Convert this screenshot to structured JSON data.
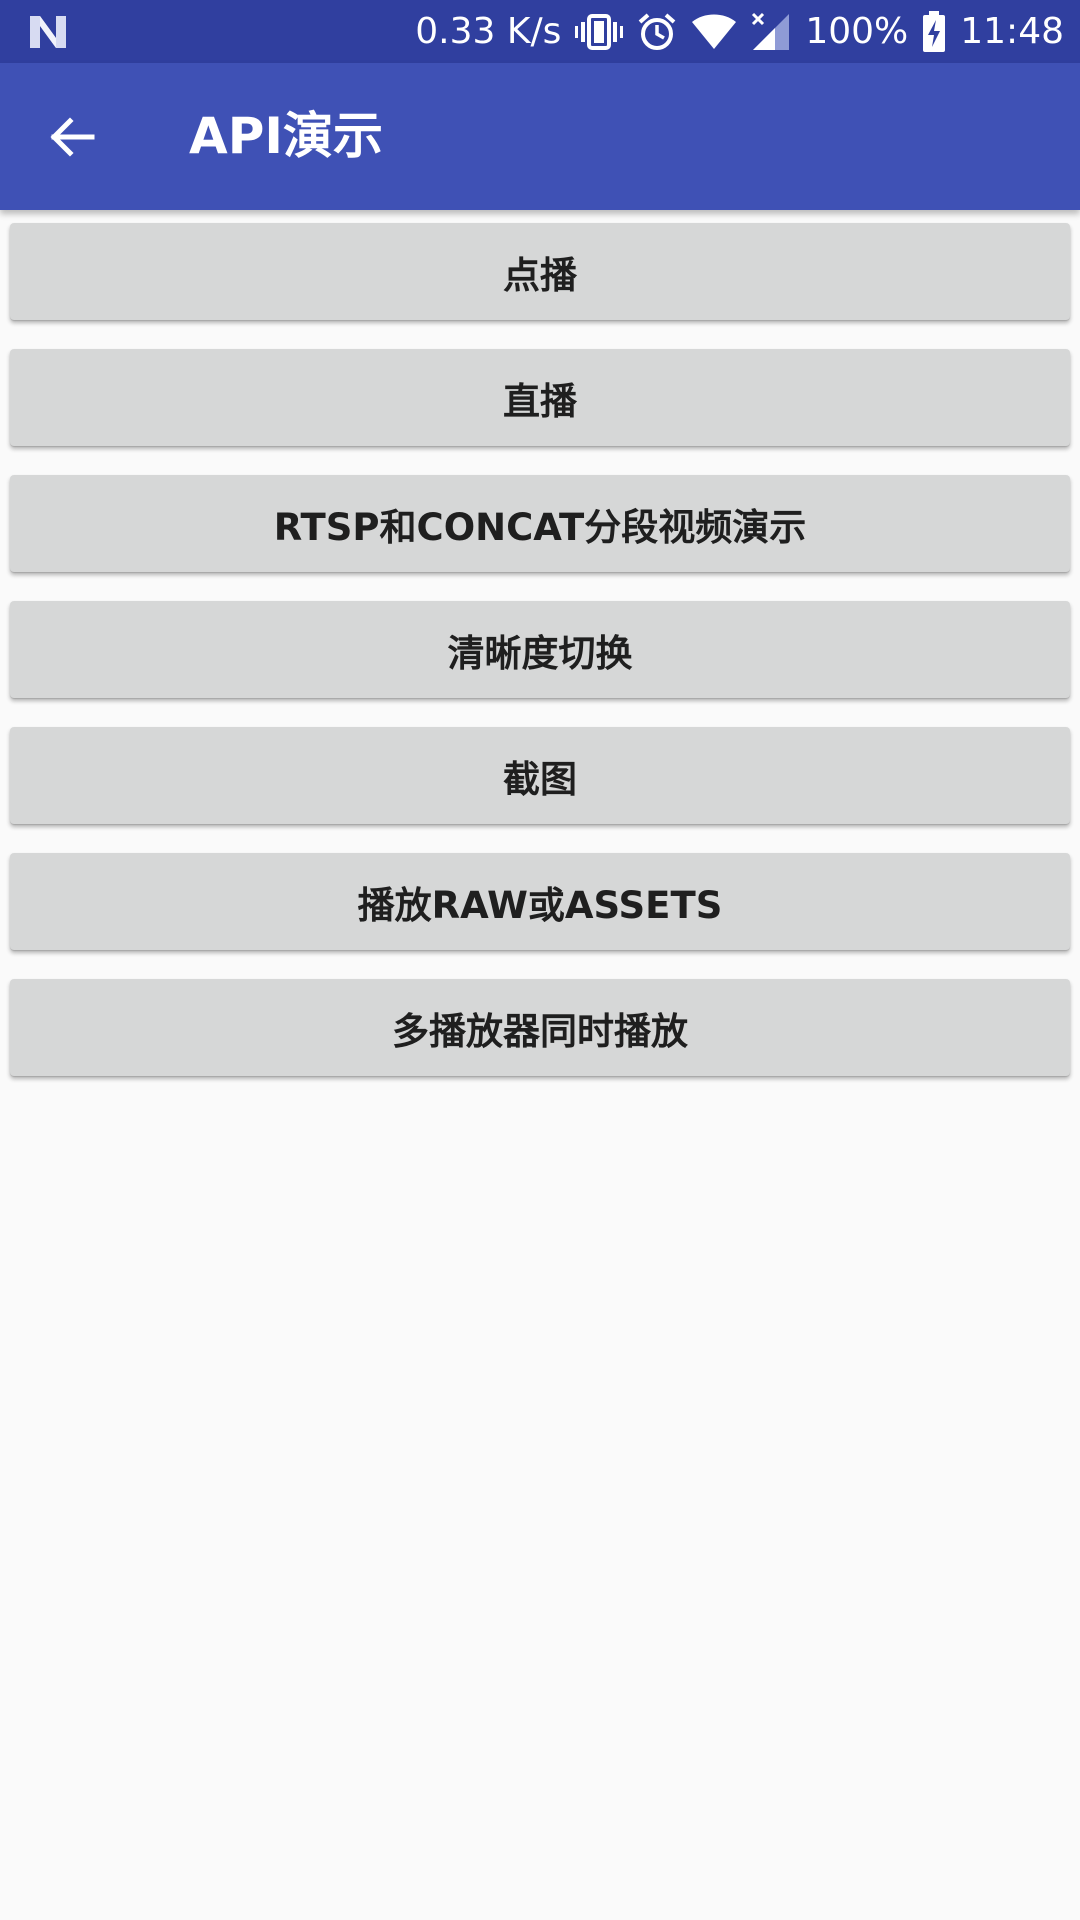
{
  "status_bar": {
    "speed": "0.33 K/s",
    "battery": "100%",
    "time": "11:48",
    "icons": [
      "n-logo-icon",
      "vibrate-icon",
      "alarm-icon",
      "wifi-icon",
      "signal-icon",
      "battery-charging-icon"
    ]
  },
  "app_bar": {
    "title": "API演示",
    "back_icon": "arrow-back-icon"
  },
  "buttons": [
    "点播",
    "直播",
    "RTSP和CONCAT分段视频演示",
    "清晰度切换",
    "截图",
    "播放RAW或ASSETS",
    "多播放器同时播放"
  ],
  "colors": {
    "status_bar": "#303f9f",
    "app_bar": "#3f51b5",
    "button_bg": "#d6d7d7",
    "background": "#fafafa"
  }
}
